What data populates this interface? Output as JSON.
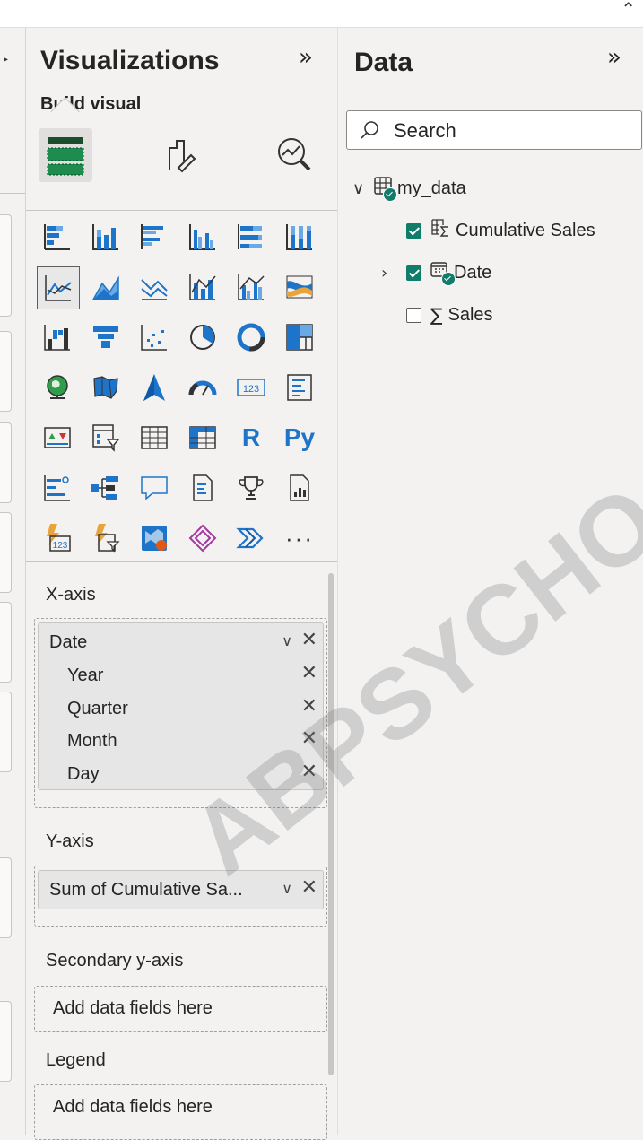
{
  "viz": {
    "title": "Visualizations",
    "collapse_glyph": "»",
    "build_visual": "Build visual",
    "icons": [
      "stacked-bar-chart-icon",
      "stacked-column-chart-icon",
      "clustered-bar-chart-icon",
      "clustered-column-chart-icon",
      "100-stacked-bar-chart-icon",
      "100-stacked-column-chart-icon",
      "line-chart-icon",
      "area-chart-icon",
      "stacked-area-chart-icon",
      "line-stacked-column-chart-icon",
      "line-clustered-column-chart-icon",
      "ribbon-chart-icon",
      "waterfall-chart-icon",
      "funnel-chart-icon",
      "scatter-chart-icon",
      "pie-chart-icon",
      "donut-chart-icon",
      "treemap-icon",
      "map-icon",
      "filled-map-icon",
      "azure-map-icon",
      "gauge-icon",
      "card-icon",
      "multi-row-card-icon",
      "kpi-icon",
      "slicer-icon",
      "table-icon",
      "matrix-icon",
      "r-visual-icon",
      "python-visual-icon",
      "key-influencers-icon",
      "decomposition-tree-icon",
      "qna-icon",
      "paginated-report-icon",
      "trophy-icon",
      "metrics-icon",
      "power-apps-card-icon",
      "power-apps-slicer-icon",
      "arcgis-map-icon",
      "power-apps-icon",
      "power-automate-icon",
      "more-visuals-icon"
    ],
    "r_label": "R",
    "py_label": "Py",
    "more_label": "···",
    "card_label": "123",
    "selected_icon_index": 6
  },
  "wells": {
    "x_axis": {
      "label": "X-axis",
      "field": "Date",
      "subfields": [
        "Year",
        "Quarter",
        "Month",
        "Day"
      ]
    },
    "y_axis": {
      "label": "Y-axis",
      "field": "Sum of Cumulative Sa..."
    },
    "secondary_y_axis": {
      "label": "Secondary y-axis",
      "placeholder": "Add data fields here"
    },
    "legend": {
      "label": "Legend",
      "placeholder": "Add data fields here"
    },
    "remove_glyph": "✕",
    "expand_glyph": "∨"
  },
  "data_pane": {
    "title": "Data",
    "collapse_glyph": "»",
    "search_placeholder": "Search",
    "table": {
      "name": "my_data",
      "fields": [
        {
          "name": "Cumulative Sales",
          "checked": true,
          "icon": "measure-table-icon"
        },
        {
          "name": "Date",
          "checked": true,
          "icon": "calendar-hierarchy-icon"
        },
        {
          "name": "Sales",
          "checked": false,
          "icon": "sigma-icon",
          "glyph": "∑"
        }
      ]
    }
  },
  "watermark": "ABPSYCHO",
  "colors": {
    "accent": "#1e74c8",
    "check": "#107c6a",
    "panel": "#f3f2f1"
  }
}
